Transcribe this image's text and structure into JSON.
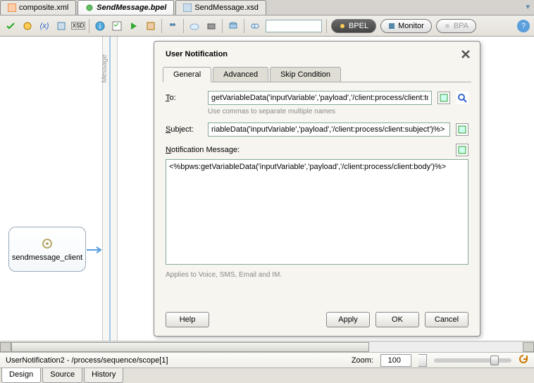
{
  "top_tabs": [
    {
      "label": "composite.xml",
      "active": false
    },
    {
      "label": "SendMessage.bpel",
      "active": true
    },
    {
      "label": "SendMessage.xsd",
      "active": false
    }
  ],
  "toolbar": {
    "bpel_label": "BPEL",
    "monitor_label": "Monitor",
    "bpa_label": "BPA"
  },
  "swimlane_label": "Message",
  "node": {
    "label": "sendmessage_client"
  },
  "dialog": {
    "title": "User Notification",
    "tabs": [
      "General",
      "Advanced",
      "Skip Condition"
    ],
    "to_label": "To:",
    "to_value": "getVariableData('inputVariable','payload','/client:process/client:to')%>",
    "to_hint": "Use commas to separate multiple names",
    "subject_label": "Subject:",
    "subject_value": "riableData('inputVariable','payload','/client:process/client:subject')%>",
    "msg_label": "Notification Message:",
    "msg_value": "<%bpws:getVariableData('inputVariable','payload','/client:process/client:body')%>",
    "applies": "Applies to Voice, SMS, Email and IM.",
    "help": "Help",
    "apply": "Apply",
    "ok": "OK",
    "cancel": "Cancel"
  },
  "status": {
    "path": "UserNotification2 - /process/sequence/scope[1]",
    "zoom_label": "Zoom:",
    "zoom_value": "100"
  },
  "bottom_tabs": [
    "Design",
    "Source",
    "History"
  ]
}
